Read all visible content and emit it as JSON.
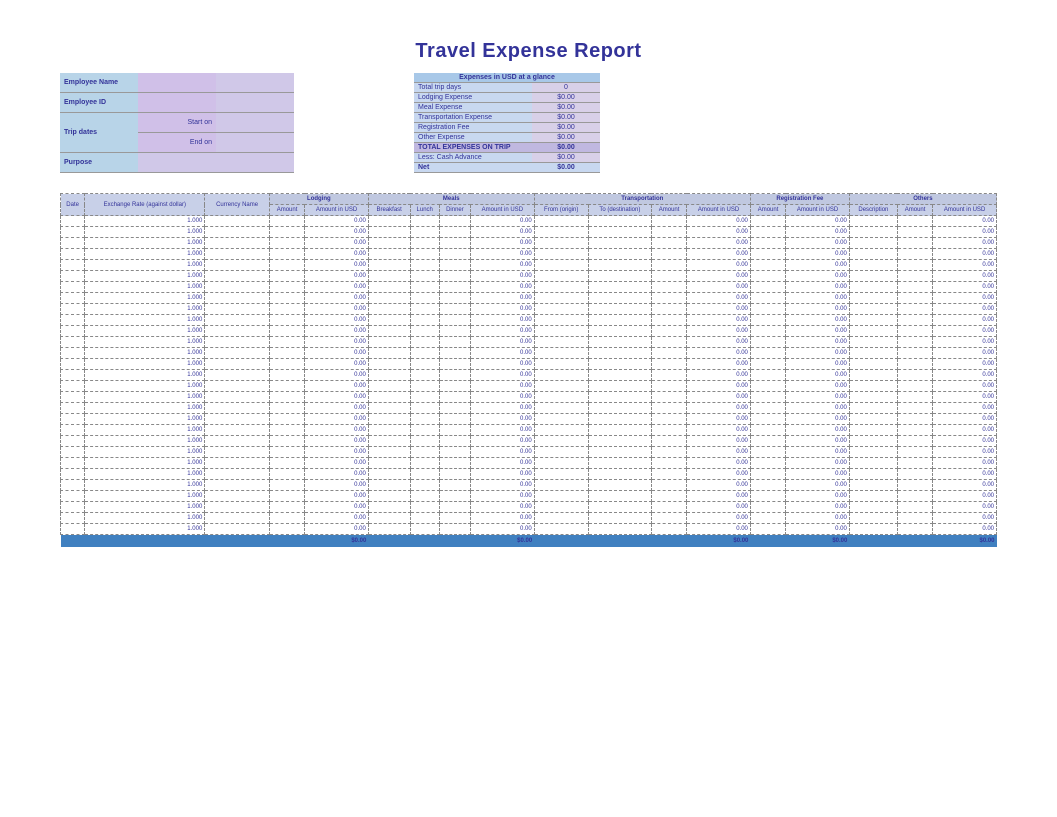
{
  "title": "Travel Expense Report",
  "info": {
    "employee_name_label": "Employee Name",
    "employee_id_label": "Employee ID",
    "trip_dates_label": "Trip dates",
    "start_on_label": "Start on",
    "end_on_label": "End on",
    "purpose_label": "Purpose"
  },
  "summary": {
    "header": "Expenses in USD at a glance",
    "rows": [
      {
        "label": "Total trip days",
        "value": "0"
      },
      {
        "label": "Lodging Expense",
        "value": "$0.00"
      },
      {
        "label": "Meal Expense",
        "value": "$0.00"
      },
      {
        "label": "Transportation Expense",
        "value": "$0.00"
      },
      {
        "label": "Registration Fee",
        "value": "$0.00"
      },
      {
        "label": "Other Expense",
        "value": "$0.00"
      }
    ],
    "total_label": "TOTAL EXPENSES ON TRIP",
    "total_value": "$0.00",
    "less_label": "Less: Cash Advance",
    "less_value": "$0.00",
    "net_label": "Net",
    "net_value": "$0.00"
  },
  "table": {
    "groups": {
      "date": "Date",
      "exchange": "Exchange Rate (against dollar)",
      "currency": "Currency Name",
      "lodging": "Lodging",
      "meals": "Meals",
      "transportation": "Transportation",
      "registration": "Registration Fee",
      "others": "Others"
    },
    "cols": {
      "amount": "Amount",
      "amount_usd": "Amount in USD",
      "breakfast": "Breakfast",
      "lunch": "Lunch",
      "dinner": "Dinner",
      "from": "From (origin)",
      "to": "To (destination)",
      "description": "Description"
    },
    "default_exchange": "1.000",
    "default_usd": "0.00",
    "row_count": 29,
    "footer_total": "$0.00"
  }
}
